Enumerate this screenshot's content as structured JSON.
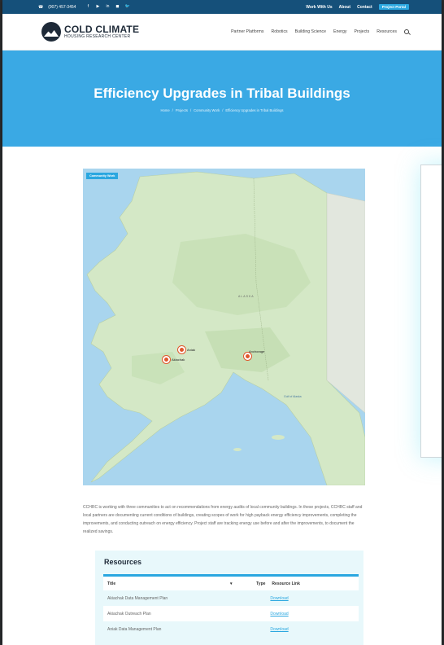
{
  "topbar": {
    "phone": "(907) 457-3454",
    "social": [
      "f",
      "▶",
      "in",
      "◼",
      "🐦"
    ],
    "links": [
      "Work With Us",
      "About",
      "Contact"
    ],
    "login": "Project Portal"
  },
  "header": {
    "logo_line1": "COLD CLIMATE",
    "logo_line2": "HOUSING RESEARCH CENTER",
    "nav": [
      "Partner Platforms",
      "Robotics",
      "Building Science",
      "Energy",
      "Projects",
      "Resources"
    ]
  },
  "hero": {
    "title": "Efficiency Upgrades in Tribal Buildings",
    "crumbs": [
      "Home",
      "/",
      "Projects",
      "/",
      "Community Work",
      "/",
      "Efficiency Upgrades in Tribal Buildings"
    ]
  },
  "map": {
    "tag": "Community Work",
    "region_label": "ALASKA",
    "pins": [
      {
        "label": "Aniak"
      },
      {
        "label": "Akiachak"
      },
      {
        "label": "Anchorage"
      }
    ],
    "water_label": "Gulf of Alaska"
  },
  "description": "CCHRC is working with three communities to act on recommendations from energy audits of local community buildings. In these projects, CCHRC staff and local partners are documenting current conditions of buildings, creating scopes of work for high payback energy efficiency improvements, completing the improvements, and conducting outreach on energy efficiency. Project staff are tracking energy use before and after the improvements, to document the realized savings.",
  "resources": {
    "title": "Resources",
    "columns": [
      "Title",
      "Type",
      "Resource Link"
    ],
    "rows": [
      {
        "title": "Akiachak Data Management Plan",
        "type": "",
        "link": "Download"
      },
      {
        "title": "Akiachak Outreach Plan",
        "type": "",
        "link": "Download"
      },
      {
        "title": "Aniak Data Management Plan",
        "type": "",
        "link": "Download"
      }
    ]
  }
}
